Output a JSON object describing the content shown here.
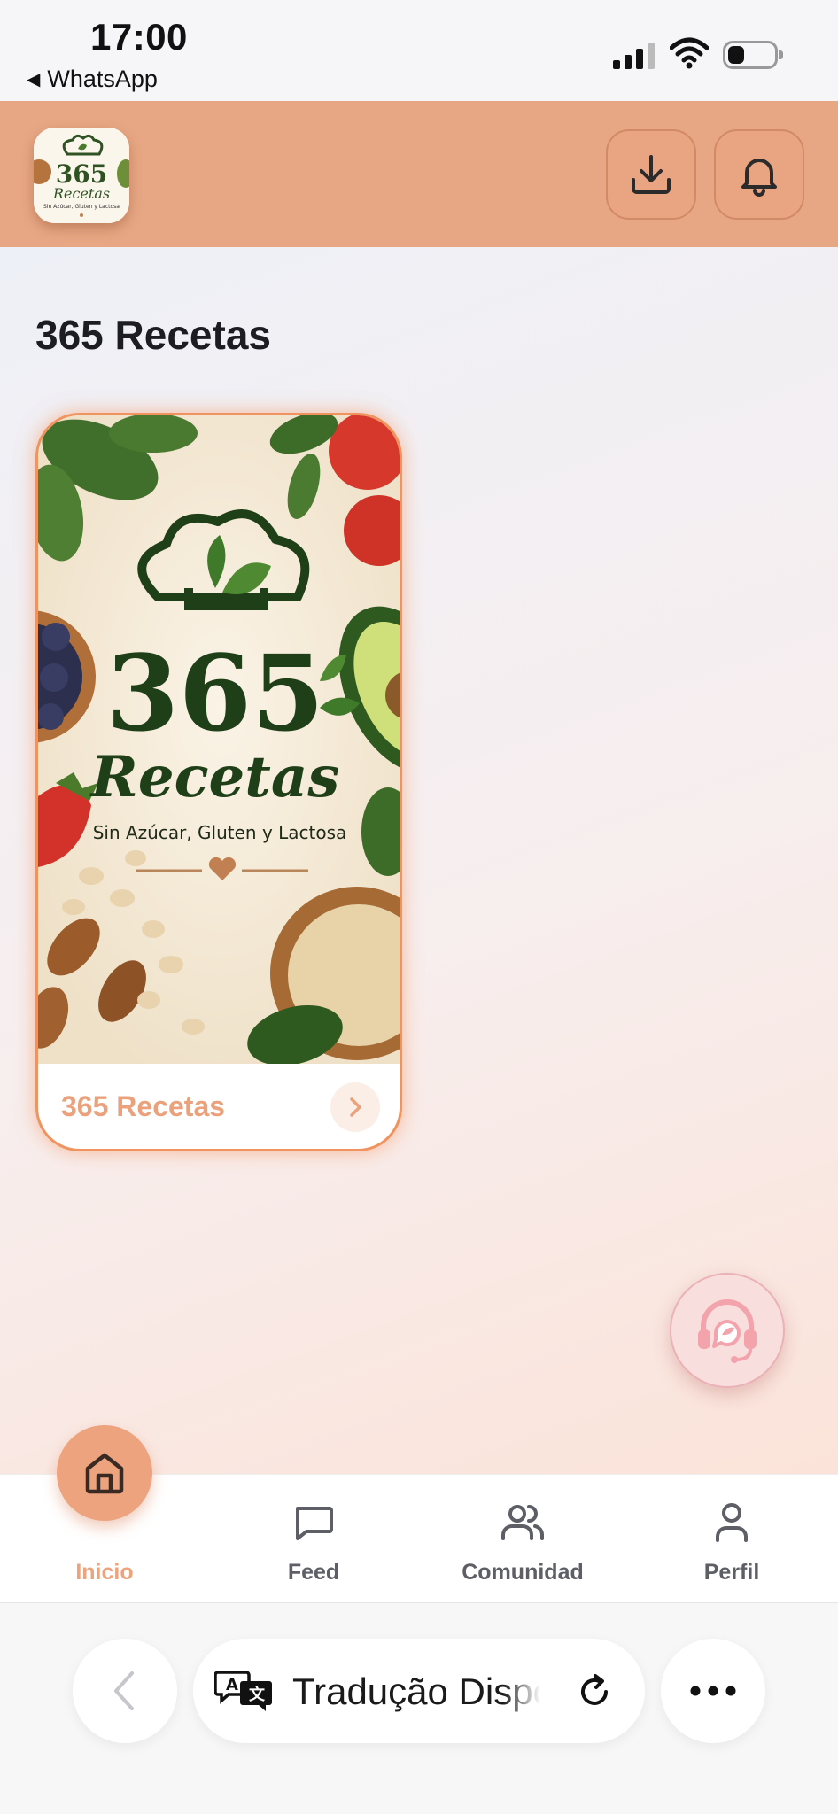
{
  "status_bar": {
    "time": "17:00",
    "back_app": "WhatsApp"
  },
  "header": {
    "logo_alt": "365 Recetas",
    "download_icon": "download-icon",
    "bell_icon": "bell-icon",
    "brand_color": "#e8a784"
  },
  "main": {
    "title": "365 Recetas",
    "cards": [
      {
        "label": "365 Recetas",
        "image": {
          "big": "365",
          "script": "Recetas",
          "subtitle": "Sin Azúcar, Gluten y Lactosa"
        }
      }
    ],
    "accent_color": "#f0935e"
  },
  "nav": {
    "items": [
      {
        "label": "Inicio",
        "icon": "home-icon",
        "active": true
      },
      {
        "label": "Feed",
        "icon": "chat-bubble-icon"
      },
      {
        "label": "Comunidad",
        "icon": "users-icon"
      },
      {
        "label": "Perfil",
        "icon": "user-icon"
      }
    ],
    "active_color": "#eca37e"
  },
  "browser": {
    "translate_text": "Tradução Disponível"
  }
}
